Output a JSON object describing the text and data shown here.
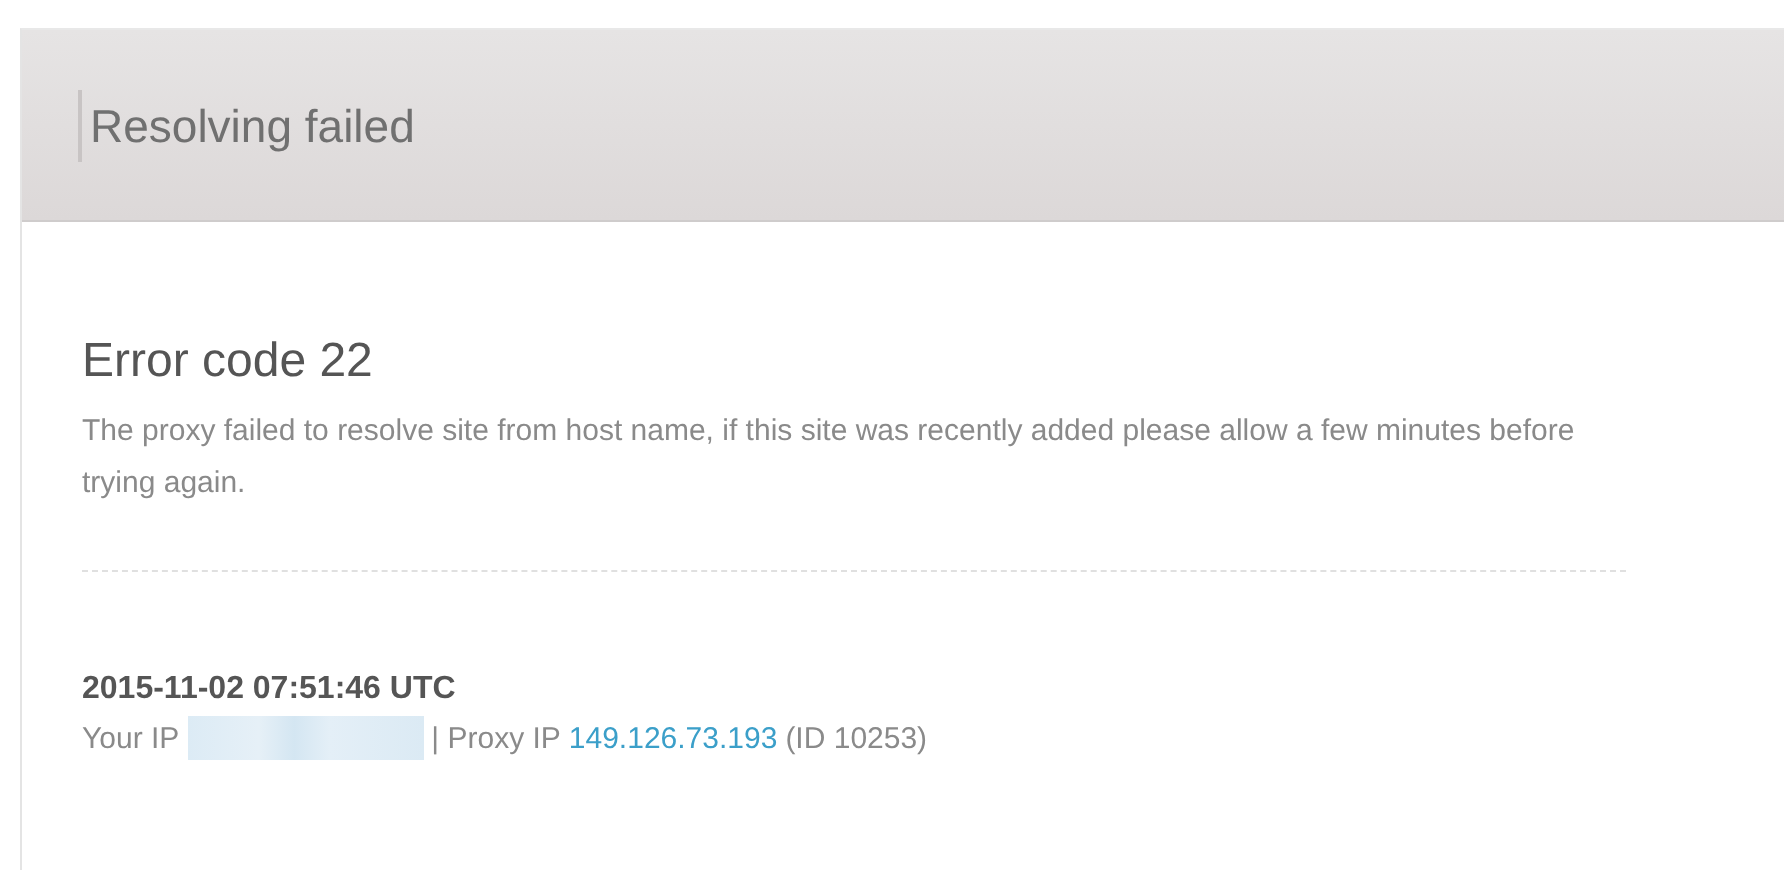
{
  "header": {
    "title": "Resolving failed"
  },
  "error": {
    "heading": "Error code 22",
    "message": "The proxy failed to resolve site from host name, if this site was recently added please allow a few minutes before trying again."
  },
  "details": {
    "timestamp": "2015-11-02 07:51:46 UTC",
    "your_ip_label": "Your IP",
    "proxy_ip_label": "| Proxy IP",
    "proxy_ip": "149.126.73.193",
    "id": "(ID 10253)"
  }
}
